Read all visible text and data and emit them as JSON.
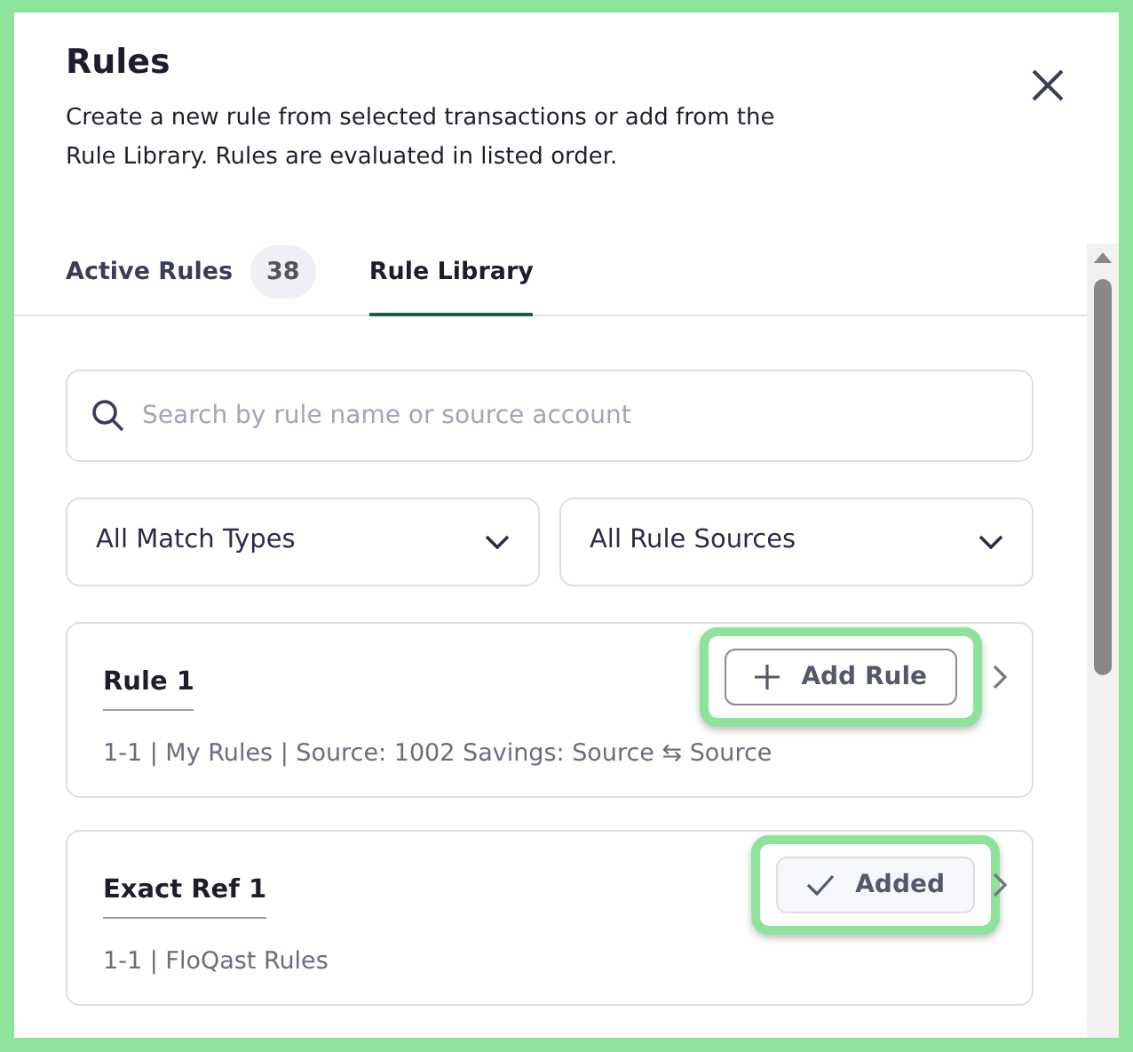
{
  "dialog": {
    "title": "Rules",
    "description": "Create a new rule from selected transactions or add from the Rule Library. Rules are evaluated in listed order."
  },
  "tabs": [
    {
      "label": "Active Rules",
      "count": "38",
      "selected": false
    },
    {
      "label": "Rule Library",
      "selected": true
    }
  ],
  "search": {
    "placeholder": "Search by rule name or source account"
  },
  "filters": [
    {
      "value": "All Match Types"
    },
    {
      "value": "All Rule Sources"
    }
  ],
  "rules": [
    {
      "name": "Rule 1",
      "details": "1-1 | My Rules | Source: 1002 Savings: Source ⇆ Source",
      "button": "Add Rule",
      "added": false,
      "highlighted": true
    },
    {
      "name": "Exact Ref 1",
      "details": "1-1 | FloQast Rules",
      "button": "Added",
      "added": true,
      "highlighted": true
    }
  ]
}
